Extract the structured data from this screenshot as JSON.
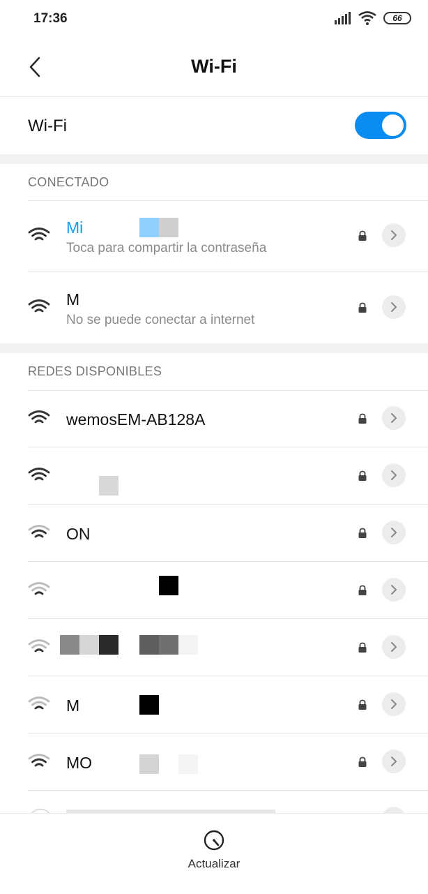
{
  "status_bar": {
    "time": "17:36",
    "battery": "66"
  },
  "header": {
    "title": "Wi-Fi"
  },
  "wifi_toggle": {
    "label": "Wi-Fi",
    "enabled": true
  },
  "sections": {
    "connected_header": "CONECTADO",
    "available_header": "REDES DISPONIBLES"
  },
  "connected": [
    {
      "name": "Mi",
      "status": "Toca para compartir la contraseña",
      "secured": true,
      "signal": "strong"
    },
    {
      "name": "M",
      "status": "No se puede conectar a internet",
      "secured": true,
      "signal": "strong"
    }
  ],
  "available": [
    {
      "name": "wemosEM-AB128A",
      "secured": true,
      "signal": "strong"
    },
    {
      "name": "",
      "secured": true,
      "signal": "strong"
    },
    {
      "name": "ON",
      "secured": true,
      "signal": "medium"
    },
    {
      "name": "",
      "secured": true,
      "signal": "weak"
    },
    {
      "name": "",
      "secured": true,
      "signal": "weak"
    },
    {
      "name": "M",
      "secured": true,
      "signal": "weak"
    },
    {
      "name": "MO",
      "secured": true,
      "signal": "medium"
    }
  ],
  "bottom": {
    "refresh_label": "Actualizar"
  },
  "colors": {
    "accent": "#0a8cf0",
    "connected_text": "#1a9ce8"
  }
}
